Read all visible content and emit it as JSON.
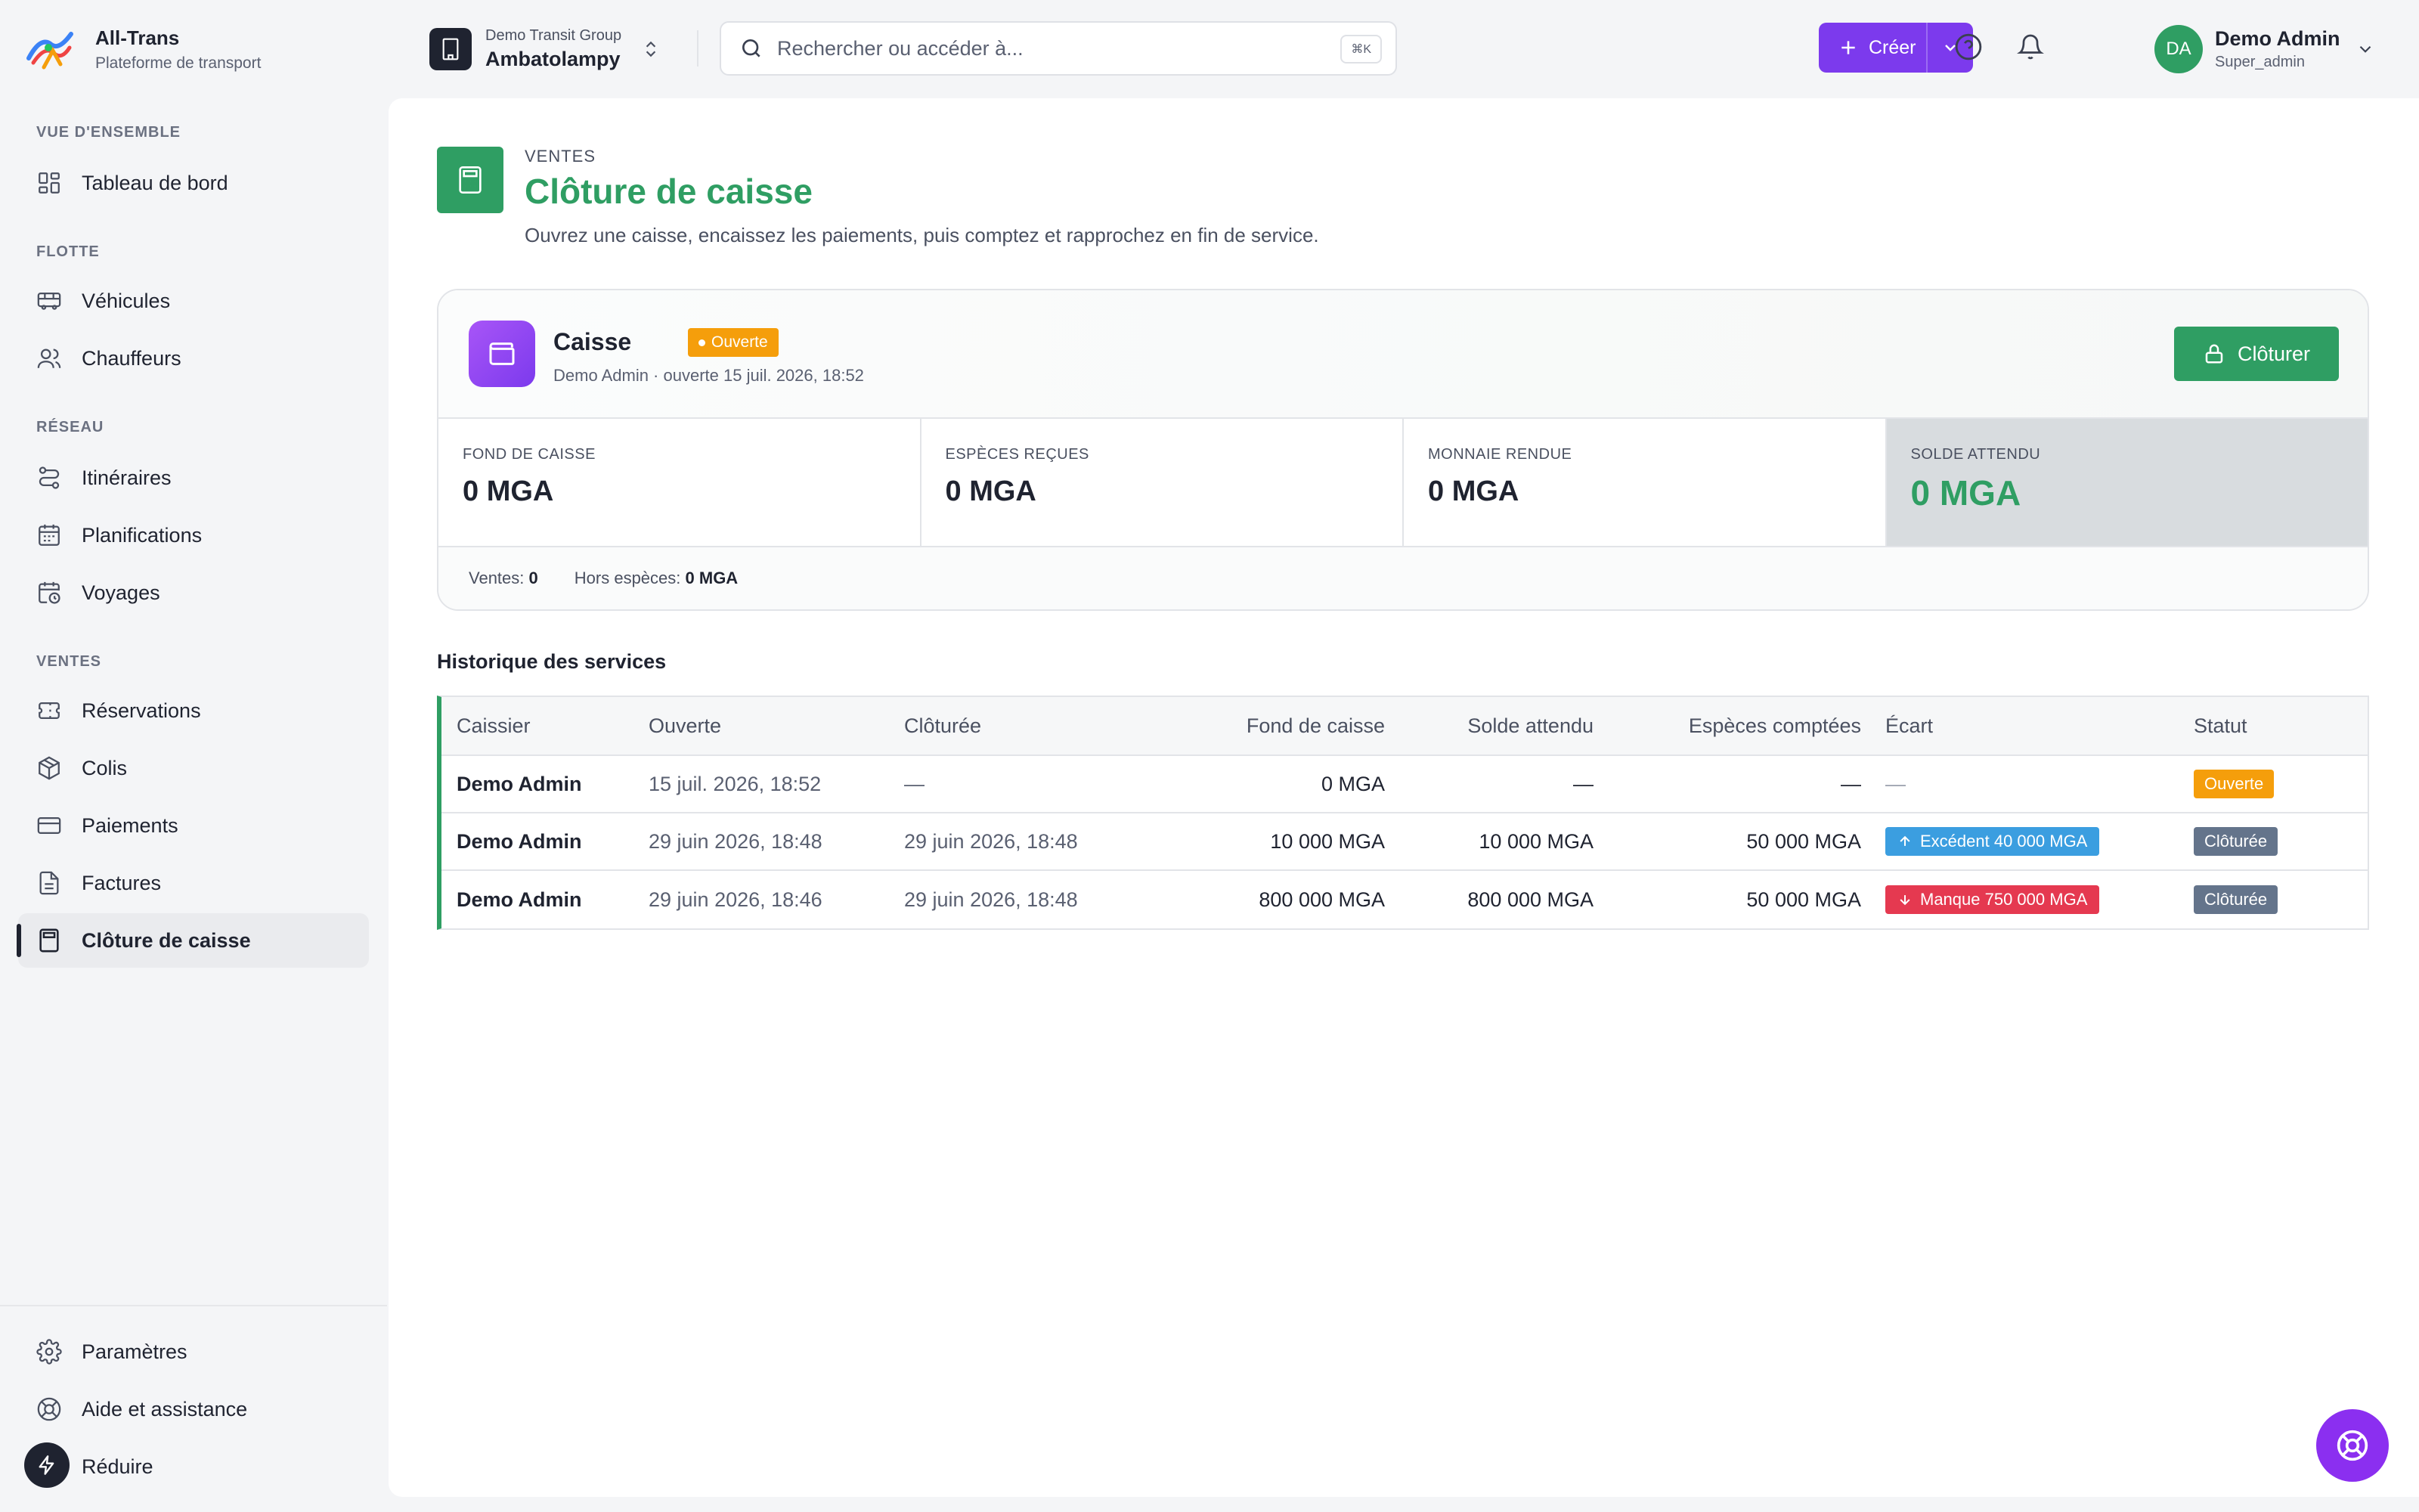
{
  "brand": {
    "name": "All-Trans",
    "subtitle": "Plateforme de transport"
  },
  "sidebar": {
    "sections": [
      {
        "title": "VUE D'ENSEMBLE"
      },
      {
        "title": "FLOTTE"
      },
      {
        "title": "RÉSEAU"
      },
      {
        "title": "VENTES"
      }
    ],
    "items": [
      {
        "label": "Tableau de bord",
        "icon": "dashboard-icon"
      },
      {
        "label": "Véhicules",
        "icon": "bus-icon"
      },
      {
        "label": "Chauffeurs",
        "icon": "users-icon"
      },
      {
        "label": "Itinéraires",
        "icon": "route-icon"
      },
      {
        "label": "Planifications",
        "icon": "calendar-icon"
      },
      {
        "label": "Voyages",
        "icon": "calendar-clock-icon"
      },
      {
        "label": "Réservations",
        "icon": "ticket-icon"
      },
      {
        "label": "Colis",
        "icon": "package-icon"
      },
      {
        "label": "Paiements",
        "icon": "credit-card-icon"
      },
      {
        "label": "Factures",
        "icon": "invoice-icon"
      },
      {
        "label": "Clôture de caisse",
        "icon": "calculator-icon",
        "active": true
      }
    ],
    "footer": [
      {
        "label": "Paramètres",
        "icon": "gear-icon"
      },
      {
        "label": "Aide et assistance",
        "icon": "lifebuoy-icon"
      },
      {
        "label": "Réduire",
        "icon": "collapse-icon"
      }
    ]
  },
  "header": {
    "org_group": "Demo Transit Group",
    "org_name": "Ambatolampy",
    "search_placeholder": "Rechercher ou accéder à...",
    "search_shortcut": "⌘K",
    "create_label": "Créer",
    "user_name": "Demo Admin",
    "user_role": "Super_admin",
    "user_initials": "DA"
  },
  "page": {
    "kicker": "VENTES",
    "title": "Clôture de caisse",
    "subtitle": "Ouvrez une caisse, encaissez les paiements, puis comptez et rapprochez en fin de service."
  },
  "register": {
    "name": "Caisse",
    "status": "Ouverte",
    "meta": "Demo Admin · ouverte 15 juil. 2026, 18:52",
    "close_label": "Clôturer",
    "stats": [
      {
        "label": "FOND DE CAISSE",
        "value": "0 MGA"
      },
      {
        "label": "ESPÈCES REÇUES",
        "value": "0 MGA"
      },
      {
        "label": "MONNAIE RENDUE",
        "value": "0 MGA"
      },
      {
        "label": "SOLDE ATTENDU",
        "value": "0 MGA"
      }
    ],
    "footer": {
      "sales_label": "Ventes:",
      "sales_value": "0",
      "non_cash_label": "Hors espèces:",
      "non_cash_value": "0 MGA"
    }
  },
  "history": {
    "title": "Historique des services",
    "columns": [
      "Caissier",
      "Ouverte",
      "Clôturée",
      "Fond de caisse",
      "Solde attendu",
      "Espèces comptées",
      "Écart",
      "Statut"
    ],
    "rows": [
      {
        "cashier": "Demo Admin",
        "opened": "15 juil. 2026, 18:52",
        "closed": "—",
        "float": "0 MGA",
        "expected": "—",
        "counted": "—",
        "diff": "—",
        "diff_type": "none",
        "status": "Ouverte",
        "status_type": "open"
      },
      {
        "cashier": "Demo Admin",
        "opened": "29 juin 2026, 18:48",
        "closed": "29 juin 2026, 18:48",
        "float": "10 000 MGA",
        "expected": "10 000 MGA",
        "counted": "50 000 MGA",
        "diff": "Excédent 40 000 MGA",
        "diff_type": "up",
        "status": "Clôturée",
        "status_type": "closed"
      },
      {
        "cashier": "Demo Admin",
        "opened": "29 juin 2026, 18:46",
        "closed": "29 juin 2026, 18:48",
        "float": "800 000 MGA",
        "expected": "800 000 MGA",
        "counted": "50 000 MGA",
        "diff": "Manque 750 000 MGA",
        "diff_type": "down",
        "status": "Clôturée",
        "status_type": "closed"
      }
    ]
  },
  "colors": {
    "accent": "#2f9e63",
    "primary": "#7c3aed",
    "warning": "#f59e0b",
    "info": "#3b9ee0",
    "danger": "#e53950",
    "neutral": "#64748b"
  }
}
